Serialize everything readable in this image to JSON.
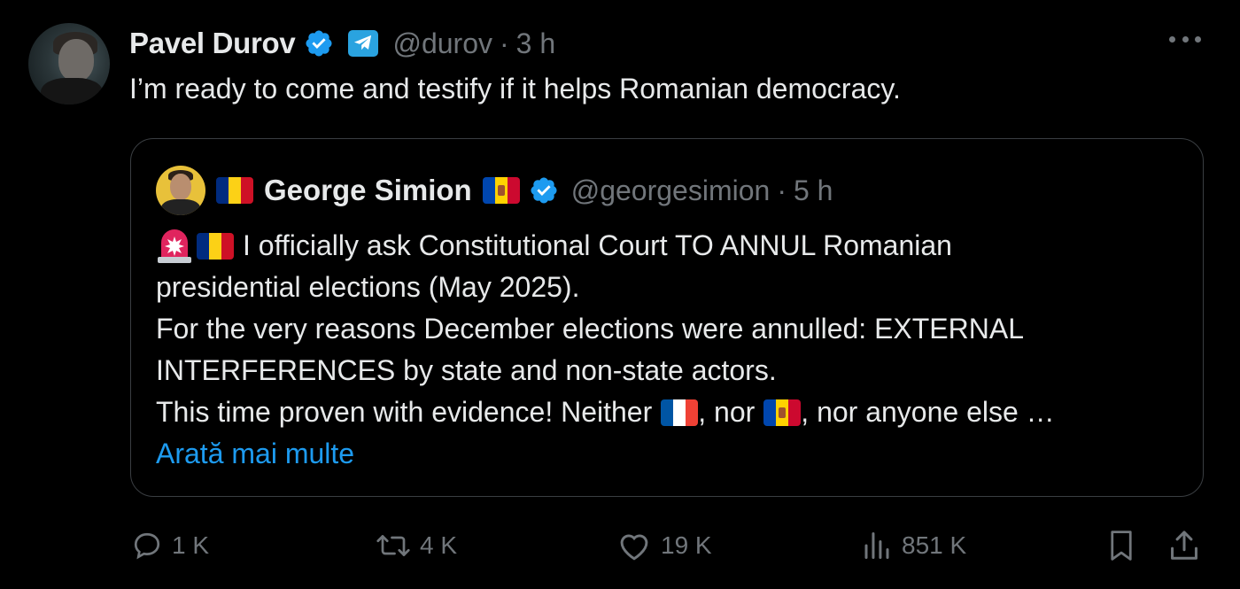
{
  "author": {
    "name": "Pavel Durov",
    "handle": "@durov",
    "separator": "·",
    "time": "3 h"
  },
  "tweet": {
    "text": "I’m ready to come and testify if it helps Romanian democracy."
  },
  "quoted": {
    "name": "George Simion",
    "handle": "@georgesimion",
    "separator": "·",
    "time": "5 h",
    "line1": "I officially ask Constitutional Court TO ANNUL Romanian",
    "line2": "presidential elections (May 2025).",
    "line3": "For the very reasons December elections were annulled: EXTERNAL",
    "line4": "INTERFERENCES by state and non-state actors.",
    "line5_a": "This time proven with evidence! Neither",
    "line5_b": ", nor",
    "line5_c": ", nor anyone else …",
    "show_more": "Arată mai multe"
  },
  "actions": {
    "replies": "1 K",
    "reposts": "4 K",
    "likes": "19 K",
    "views": "851 K"
  },
  "colors": {
    "background": "#000000",
    "text": "#e7e9ea",
    "muted": "#71767b",
    "accent": "#1d9bf0",
    "border": "#3a3e42"
  },
  "icons": {
    "verified": "verified-badge-icon",
    "telegram": "telegram-icon",
    "more": "more-icon",
    "reply": "reply-icon",
    "repost": "repost-icon",
    "like": "heart-icon",
    "views": "views-icon",
    "bookmark": "bookmark-icon",
    "share": "share-icon"
  }
}
